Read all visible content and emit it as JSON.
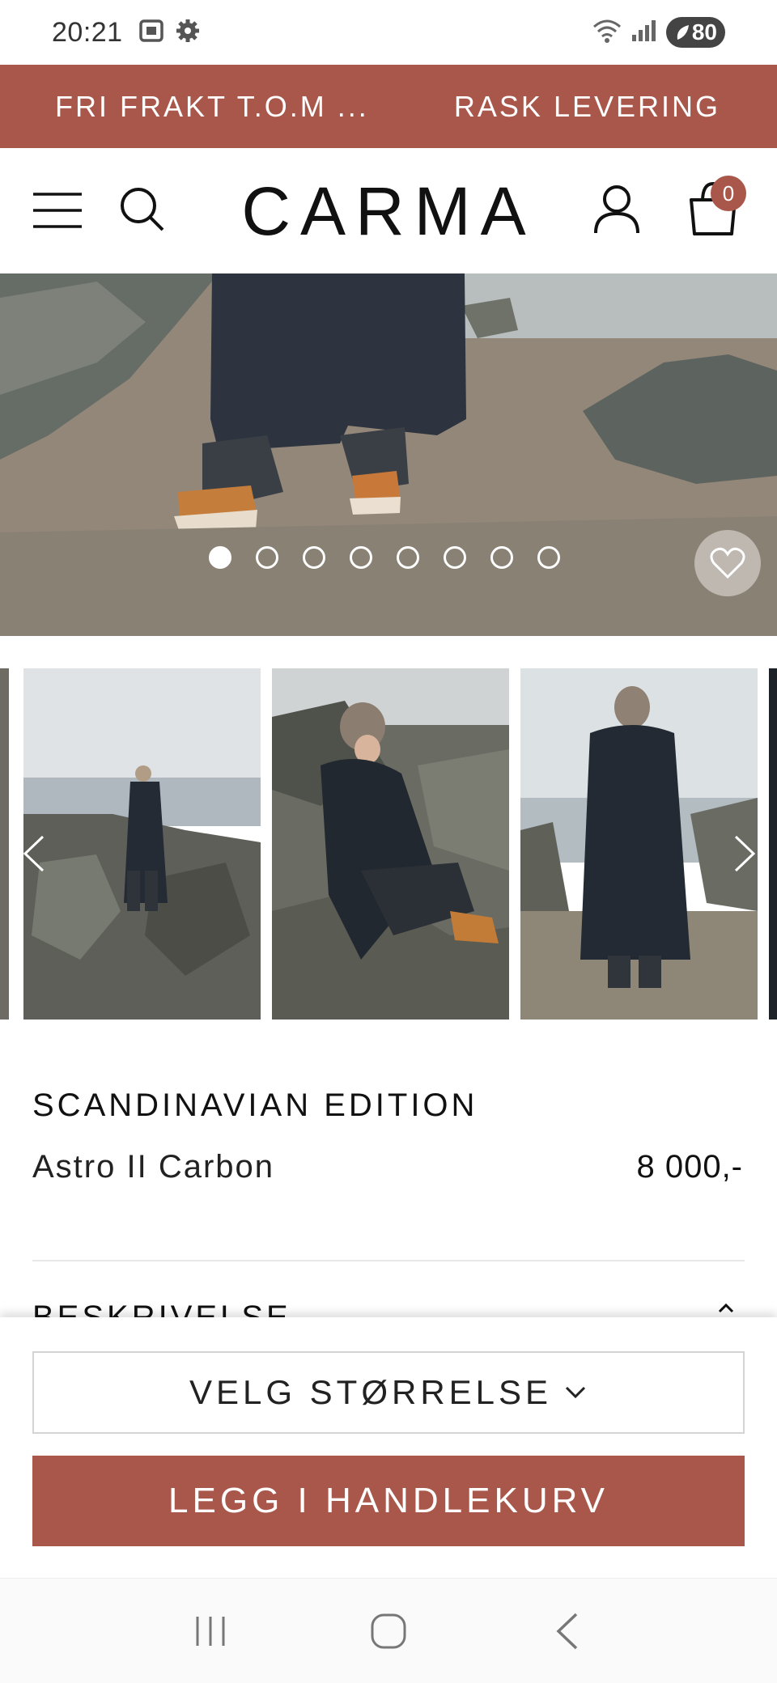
{
  "status_bar": {
    "time": "20:21",
    "battery": "80",
    "icons": [
      "screenshot-icon",
      "settings-icon",
      "wifi-icon",
      "signal-icon",
      "battery-icon"
    ]
  },
  "promo": {
    "left_text": "FRI FRAKT T.O.M ...",
    "right_text": "RASK LEVERING"
  },
  "header": {
    "logo": "CARMA",
    "cart_count": "0"
  },
  "hero": {
    "slide_count": 8,
    "active_slide": 1
  },
  "product": {
    "brand": "SCANDINAVIAN EDITION",
    "name": "Astro II Carbon",
    "price": "8 000,-",
    "description_label": "BESKRIVELSE"
  },
  "actions": {
    "size_select_label": "VELG STØRRELSE",
    "add_to_cart_label": "LEGG I HANDLEKURV"
  },
  "colors": {
    "brand": "#a9574a",
    "text": "#111111",
    "divider": "#e8e8e8"
  }
}
